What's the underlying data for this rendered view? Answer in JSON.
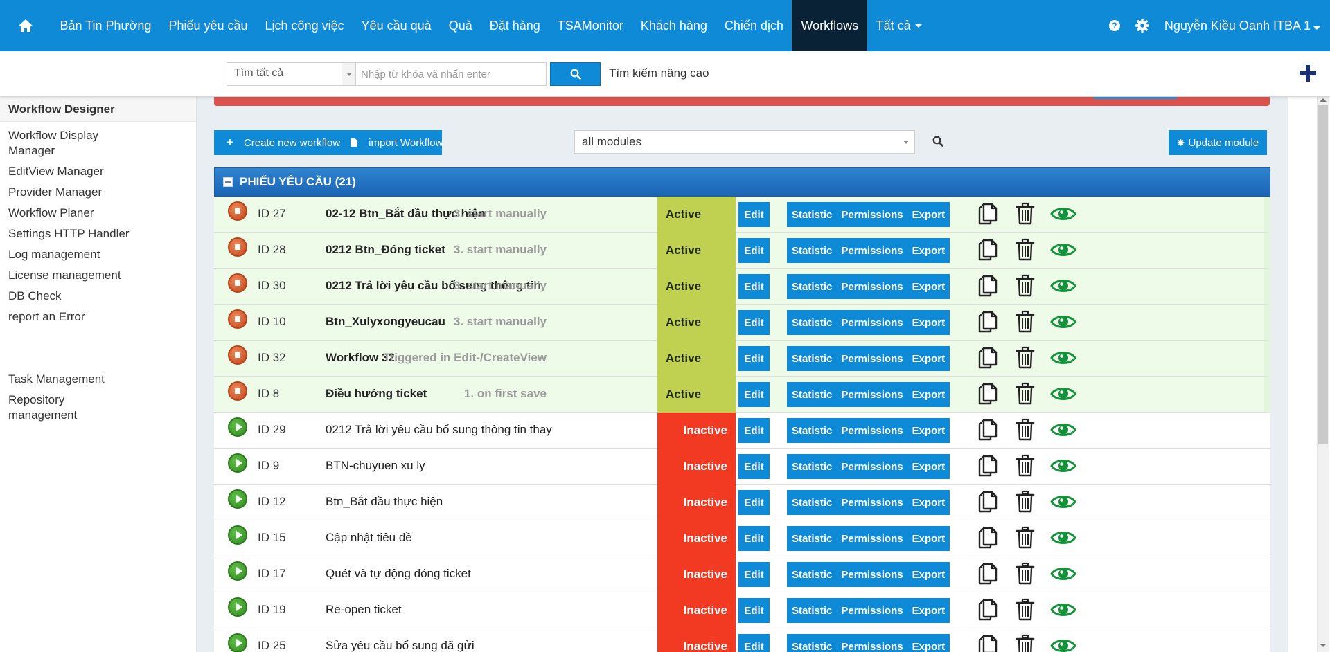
{
  "nav": {
    "items": [
      "Bản Tin Phường",
      "Phiếu yêu cầu",
      "Lịch công việc",
      "Yêu cầu quà",
      "Quà",
      "Đặt hàng",
      "TSAMonitor",
      "Khách hàng",
      "Chiến dịch",
      "Workflows",
      "Tất cả"
    ],
    "active": "Workflows",
    "help": "?",
    "user": "Nguyễn Kiều Oanh ITBA 1"
  },
  "search": {
    "scope": "Tìm tất cả",
    "placeholder": "Nhập từ khóa và nhấn enter",
    "advanced": "Tìm kiếm nâng cao"
  },
  "sidebar": {
    "title": "Workflow Designer",
    "items": [
      "Workflow Display Manager",
      "EditView Manager",
      "Provider Manager",
      "Workflow Planer",
      "Settings HTTP Handler",
      "Log management",
      "License management",
      "DB Check",
      "report an Error"
    ],
    "items2": [
      "Task Management",
      "Repository management"
    ]
  },
  "toolbar": {
    "create": "Create new workflow",
    "import": "import Workflow",
    "module": "all modules",
    "update": "Update module"
  },
  "group": {
    "title": "PHIẾU YÊU CẦU (21)"
  },
  "actions": {
    "edit": "Edit",
    "statistic": "Statistic",
    "permissions": "Permissions",
    "export": "Export"
  },
  "rows": [
    {
      "id": "ID 27",
      "name": "02-12 Btn_Bắt đầu thực hiện",
      "trigger": "3. start manually",
      "status": "Active"
    },
    {
      "id": "ID 28",
      "name": "0212 Btn_Đóng ticket",
      "trigger": "3. start manually",
      "status": "Active"
    },
    {
      "id": "ID 30",
      "name": "0212 Trả lời yêu cầu bổ sung thông tin",
      "trigger": "3. start manually",
      "status": "Active"
    },
    {
      "id": "ID 10",
      "name": "Btn_Xulyxongyeucau",
      "trigger": "3. start manually",
      "status": "Active"
    },
    {
      "id": "ID 32",
      "name": "Workflow 32",
      "trigger": "Triggered in Edit-/CreateView",
      "status": "Active"
    },
    {
      "id": "ID 8",
      "name": "Điều hướng ticket",
      "trigger": "1. on first save",
      "status": "Active"
    },
    {
      "id": "ID 29",
      "name": "0212 Trả lời yêu cầu bổ sung thông tin thay",
      "trigger": "",
      "status": "Inactive"
    },
    {
      "id": "ID 9",
      "name": "BTN-chuyuen xu ly",
      "trigger": "",
      "status": "Inactive"
    },
    {
      "id": "ID 12",
      "name": "Btn_Bắt đầu thực hiện",
      "trigger": "",
      "status": "Inactive"
    },
    {
      "id": "ID 15",
      "name": "Cập nhật tiêu đề",
      "trigger": "",
      "status": "Inactive"
    },
    {
      "id": "ID 17",
      "name": "Quét và tự động đóng ticket",
      "trigger": "",
      "status": "Inactive"
    },
    {
      "id": "ID 19",
      "name": "Re-open ticket",
      "trigger": "",
      "status": "Inactive"
    },
    {
      "id": "ID 25",
      "name": "Sửa yêu cầu bổ sung đã gửi",
      "trigger": "",
      "status": "Inactive"
    }
  ]
}
